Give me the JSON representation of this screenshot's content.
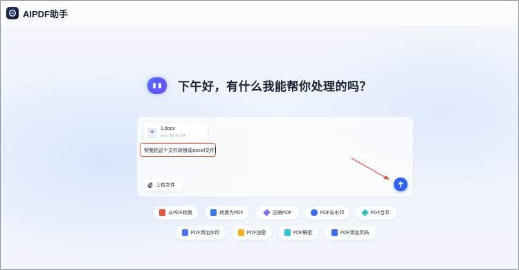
{
  "app": {
    "title": "AIPDF助手"
  },
  "greeting": {
    "text": "下午好，有什么我能帮你处理的吗？"
  },
  "composer": {
    "file": {
      "name": "1.docx",
      "meta": "docx 283.43 KB",
      "type_badge": "W"
    },
    "prompt_text": "帮我把这个文件转换成excel文件",
    "upload_label": "上传文件",
    "send_icon": "arrow-up-icon"
  },
  "colors": {
    "accent": "#2f63f0",
    "annotation": "#d9543a"
  },
  "tools_row1": [
    {
      "label": "从PDF转换",
      "icon": "pdf-from-icon",
      "color": "#e8553d"
    },
    {
      "label": "转换为PDF",
      "icon": "pdf-to-icon",
      "color": "#3a7bf0"
    },
    {
      "label": "压缩PDF",
      "icon": "compress-icon",
      "color": "#8a6cf0"
    },
    {
      "label": "PDF去水印",
      "icon": "remove-watermark-icon",
      "color": "#3a6cf0"
    },
    {
      "label": "PDF合并",
      "icon": "merge-icon",
      "color": "#2cc3b0"
    }
  ],
  "tools_row2": [
    {
      "label": "PDF添加水印",
      "icon": "add-watermark-icon",
      "color": "#4a72f2"
    },
    {
      "label": "PDF加密",
      "icon": "encrypt-icon",
      "color": "#f3b323"
    },
    {
      "label": "PDF解密",
      "icon": "decrypt-icon",
      "color": "#36c2d0"
    },
    {
      "label": "PDF添加页码",
      "icon": "page-number-icon",
      "color": "#3d6cf0"
    }
  ]
}
